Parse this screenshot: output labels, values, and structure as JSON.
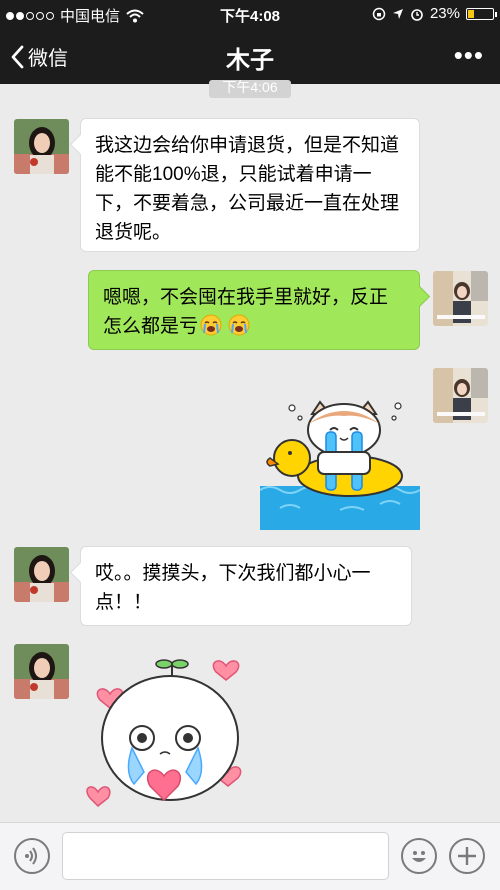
{
  "status_bar": {
    "carrier": "中国电信",
    "time": "下午4:08",
    "battery_percent": "23%",
    "battery_level": 0.23,
    "signal_bars_filled": 2,
    "signal_bars_total": 5
  },
  "nav": {
    "back_label": "微信",
    "title": "木子",
    "more_label": "•••"
  },
  "chat": {
    "time_chip": "下午4:06",
    "messages": [
      {
        "side": "left",
        "type": "text",
        "text": "我这边会给你申请退货，但是不知道能不能100%退，只能试着申请一下，不要着急，公司最近一直在处理退货呢。"
      },
      {
        "side": "right",
        "type": "text",
        "text": "嗯嗯，不会囤在我手里就好，反正怎么都是亏",
        "emojis": [
          "crying-face",
          "crying-face"
        ]
      },
      {
        "side": "right",
        "type": "sticker",
        "sticker": "crying-cat-on-duck-float"
      },
      {
        "side": "left",
        "type": "text",
        "text": "哎。。摸摸头，下次我们都小心一点！！"
      },
      {
        "side": "left",
        "type": "sticker",
        "sticker": "crying-bun-with-hearts"
      }
    ]
  },
  "input_bar": {
    "voice_icon": "voice-icon",
    "smiley_icon": "smiley-icon",
    "plus_icon": "plus-icon"
  },
  "colors": {
    "top_bar": "#1c1c1c",
    "chat_bg": "#ebebeb",
    "green_bubble": "#a0e75a",
    "white_bubble": "#ffffff"
  }
}
